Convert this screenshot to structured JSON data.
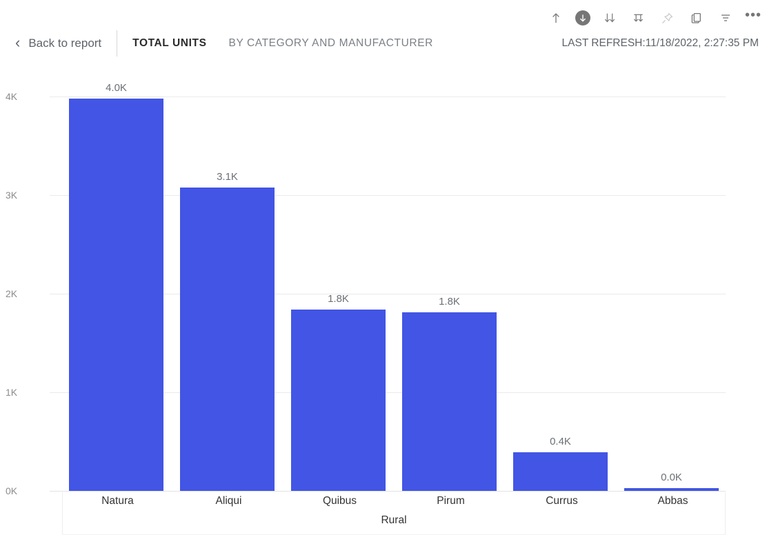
{
  "toolbar": {
    "items": [
      {
        "name": "sort-ascending-icon",
        "label": "Sort ascending",
        "state": "normal"
      },
      {
        "name": "sort-descending-icon",
        "label": "Sort descending",
        "state": "active"
      },
      {
        "name": "sort-double-down-icon",
        "label": "Sort by",
        "state": "normal"
      },
      {
        "name": "sort-axis-icon",
        "label": "Sort axis",
        "state": "normal"
      },
      {
        "name": "pin-icon",
        "label": "Pin visual",
        "state": "faded"
      },
      {
        "name": "copy-icon",
        "label": "Copy visual",
        "state": "normal"
      },
      {
        "name": "filter-icon",
        "label": "Filters",
        "state": "normal"
      },
      {
        "name": "more-options-icon",
        "label": "More options",
        "state": "normal"
      }
    ],
    "more_glyph": "•••"
  },
  "header": {
    "back_chevron": "‹",
    "back_label": "Back to report",
    "title": "TOTAL UNITS",
    "subtitle": "BY CATEGORY AND MANUFACTURER",
    "last_refresh": "LAST REFRESH:11/18/2022, 2:27:35 PM"
  },
  "colors": {
    "bar": "#4255e5",
    "gridline": "#eaeaea",
    "axis_text": "#333333",
    "tick_text": "#8c8c8c",
    "label_text": "#6b7075"
  },
  "chart_data": {
    "type": "bar",
    "title": "TOTAL UNITS",
    "subtitle": "BY CATEGORY AND MANUFACTURER",
    "xlabel": "Rural",
    "ylabel": "",
    "categories": [
      "Natura",
      "Aliqui",
      "Quibus",
      "Pirum",
      "Currus",
      "Abbas"
    ],
    "values": [
      3980,
      3080,
      1840,
      1810,
      390,
      30
    ],
    "data_labels": [
      "4.0K",
      "3.1K",
      "1.8K",
      "1.8K",
      "0.4K",
      "0.0K"
    ],
    "ylim": [
      0,
      4000
    ],
    "yticks": [
      0,
      1000,
      2000,
      3000,
      4000
    ],
    "ytick_labels": [
      "0K",
      "1K",
      "2K",
      "3K",
      "4K"
    ],
    "grid": true,
    "legend": false,
    "series": [
      {
        "name": "Total units",
        "values": [
          3980,
          3080,
          1840,
          1810,
          390,
          30
        ]
      }
    ]
  }
}
